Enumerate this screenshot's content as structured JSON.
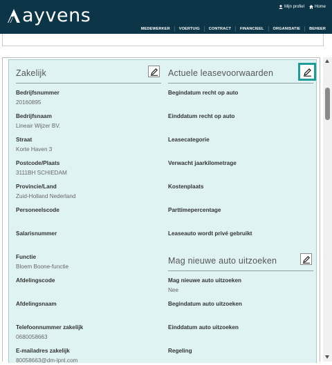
{
  "header": {
    "brand": "ayvens",
    "user_links": [
      {
        "icon": "user-icon",
        "label": "Mijn profiel"
      },
      {
        "icon": "home-icon",
        "label": "Home"
      }
    ],
    "nav": [
      "MEDEWERKER",
      "VOERTUIG",
      "CONTRACT",
      "FINANCIEEL",
      "ORGANISATIE",
      "BEHEER"
    ]
  },
  "left_section": {
    "title": "Zakelijk",
    "edit_icon": "pencil-icon",
    "fields": [
      {
        "label": "Bedrijfsnummer",
        "value": "20160895"
      },
      {
        "label": "Bedrijfsnaam",
        "value": "Lineair Wijzer BV."
      },
      {
        "label": "Straat",
        "value": "Korte Haven 3"
      },
      {
        "label": "Postcode/Plaats",
        "value": "3111BH SCHIEDAM"
      },
      {
        "label": "Provincie/Land",
        "value": "Zuid-Holland Nederland"
      },
      {
        "label": "Personeelscode",
        "value": ""
      },
      {
        "label": "Salarisnummer",
        "value": ""
      },
      {
        "label": "Functie",
        "value": "Bloem Boone-functie"
      },
      {
        "label": "Afdelingscode",
        "value": ""
      },
      {
        "label": "Afdelingsnaam",
        "value": ""
      },
      {
        "label": "Telefoonnummer zakelijk",
        "value": "0680058663"
      },
      {
        "label": "E-mailadres zakelijk",
        "value": "80058663@dm-lpnl.com"
      }
    ]
  },
  "right_section": {
    "title": "Actuele leasevoorwaarden",
    "edit_icon": "pencil-icon",
    "fields": [
      {
        "label": "Begindatum recht op auto",
        "value": ""
      },
      {
        "label": "Einddatum recht op auto",
        "value": ""
      },
      {
        "label": "Leasecategorie",
        "value": ""
      },
      {
        "label": "Verwacht jaarkilometrage",
        "value": ""
      },
      {
        "label": "Kostenplaats",
        "value": ""
      },
      {
        "label": "Parttimepercentage",
        "value": ""
      },
      {
        "label": "Leaseauto wordt privé gebruikt",
        "value": ""
      }
    ]
  },
  "right_section2": {
    "title": "Mag nieuwe auto uitzoeken",
    "edit_icon": "pencil-icon",
    "fields": [
      {
        "label": "Mag nieuwe auto uitzoeken",
        "value": "Nee"
      },
      {
        "label": "Begindatum auto uitzoeken",
        "value": ""
      },
      {
        "label": "Einddatum auto uitzoeken",
        "value": ""
      },
      {
        "label": "Regeling",
        "value": ""
      }
    ]
  },
  "colors": {
    "header_bg": "#0c3547",
    "panel_bg": "#dff3f2",
    "accent": "#1e9c95"
  }
}
